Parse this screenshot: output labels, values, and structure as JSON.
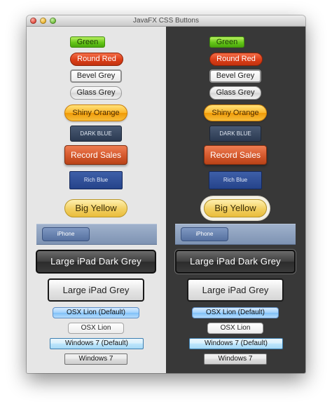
{
  "window": {
    "title": "JavaFX CSS Buttons",
    "controls": [
      "close",
      "minimize",
      "zoom"
    ]
  },
  "panels": {
    "left": {
      "background": "#e6e6e6"
    },
    "right": {
      "background": "#383838"
    }
  },
  "buttons": {
    "green": "Green",
    "round_red": "Round Red",
    "bevel_grey": "Bevel Grey",
    "glass_grey": "Glass Grey",
    "shiny_orange": "Shiny Orange",
    "dark_blue": "DARK BLUE",
    "record_sales": "Record Sales",
    "rich_blue": "Rich Blue",
    "big_yellow": "Big Yellow",
    "iphone": "iPhone",
    "ipad_dark_grey": "Large iPad Dark Grey",
    "ipad_grey": "Large iPad Grey",
    "osx_lion_default": "OSX Lion (Default)",
    "osx_lion": "OSX Lion",
    "windows7_default": "Windows 7 (Default)",
    "windows7": "Windows 7"
  },
  "colors": {
    "green": "#66c719",
    "round_red": "#db3d17",
    "shiny_orange": "#fbb52a",
    "dark_blue": "#2b3a52",
    "record_sales": "#d4582c",
    "rich_blue": "#25438a",
    "big_yellow": "#f2cf61",
    "iphone_bar": "#8ea1bf",
    "ipad_dark_grey": "#3e3e3e",
    "lion_default_blue": "#9fd0fb",
    "windows7_default_blue": "#bee6fd"
  }
}
